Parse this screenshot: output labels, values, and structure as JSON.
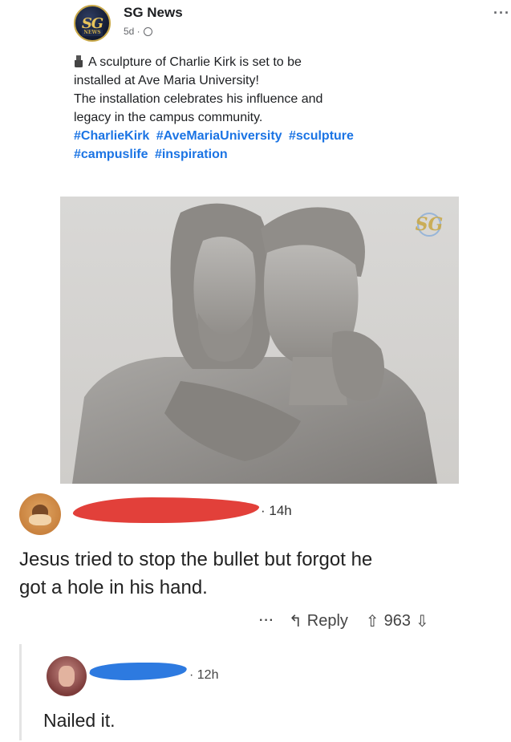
{
  "post": {
    "page_name": "SG News",
    "avatar_text": "SG",
    "avatar_subtext": "NEWS",
    "time": "5d ·",
    "more": "···",
    "text_lines": [
      "A sculpture of Charlie Kirk is set to be",
      "installed at Ave Maria University!",
      "The installation celebrates his influence and",
      "legacy in the campus community."
    ],
    "hashtags_line1": [
      "#CharlieKirk",
      "#AveMariaUniversity",
      "#sculpture"
    ],
    "hashtags_line2": [
      "#campuslife",
      "#inspiration"
    ],
    "image_watermark": "SG"
  },
  "comment1": {
    "time": "· 14h",
    "body_lines": [
      "Jesus tried to stop the bullet but forgot he",
      "got a hole in his hand."
    ],
    "more": "···",
    "reply_label": "Reply",
    "vote_count": "963",
    "colors": {
      "redaction": "#e2403a"
    }
  },
  "comment2": {
    "time": "· 12h",
    "body": "Nailed it.",
    "colors": {
      "redaction": "#2d7ae0"
    }
  }
}
